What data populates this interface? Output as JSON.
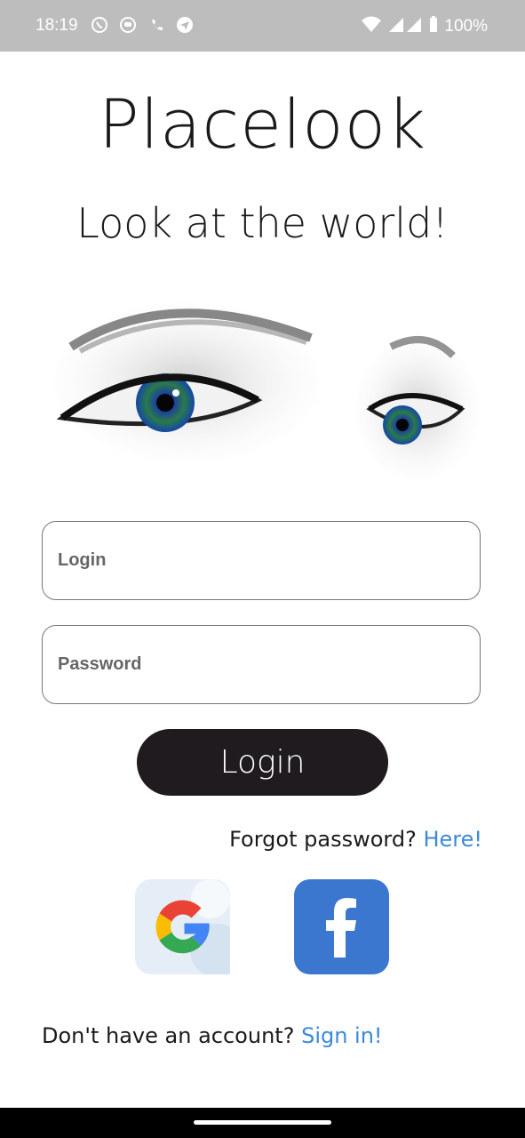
{
  "status_bar": {
    "time": "18:19",
    "battery": "100%",
    "left_icons": [
      "viber-icon",
      "messenger-icon",
      "phone-icon",
      "send-icon"
    ]
  },
  "app": {
    "title": "Placelook",
    "subtitle": "Look at the world!"
  },
  "form": {
    "login_placeholder": "Login",
    "password_placeholder": "Password",
    "login_button": "Login"
  },
  "forgot": {
    "text": "Forgot password?",
    "link": "Here!"
  },
  "social": {
    "google": "google-icon",
    "facebook": "facebook-icon"
  },
  "signup": {
    "text": "Don't have an account?",
    "link": "Sign in!"
  },
  "colors": {
    "link": "#3a8ad8",
    "button": "#1f1b1e",
    "facebook": "#3b76cf"
  }
}
